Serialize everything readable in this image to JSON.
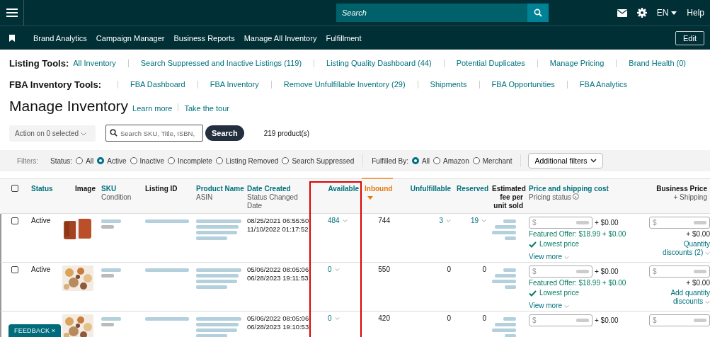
{
  "top_bar": {
    "search": {
      "placeholder": "Search"
    },
    "language": "EN",
    "help": "Help"
  },
  "nav": {
    "items": [
      "Brand Analytics",
      "Campaign Manager",
      "Business Reports",
      "Manage All Inventory",
      "Fulfillment"
    ],
    "edit_button": "Edit"
  },
  "listing_tools": {
    "label": "Listing Tools:",
    "links": [
      "All Inventory",
      "Search Suppressed and Inactive Listings (119)",
      "Listing Quality Dashboard (44)",
      "Potential Duplicates",
      "Manage Pricing",
      "Brand Health (0)"
    ]
  },
  "fba_tools": {
    "label": "FBA Inventory Tools:",
    "links": [
      "FBA Dashboard",
      "FBA Inventory",
      "Remove Unfulfillable Inventory (29)",
      "Shipments",
      "FBA Opportunities",
      "FBA Analytics"
    ]
  },
  "page": {
    "title": "Manage Inventory",
    "links": [
      "Learn more",
      "Take the tour"
    ]
  },
  "actions": {
    "action_dropdown": "Action on 0 selected",
    "search": {
      "placeholder": "Search SKU, Title, ISBN,"
    },
    "search_button": "Search",
    "count": "219 product(s)"
  },
  "filters": {
    "label": "Filters:",
    "status": {
      "label": "Status:",
      "options": [
        {
          "label": "All",
          "selected": false
        },
        {
          "label": "Active",
          "selected": true
        },
        {
          "label": "Inactive",
          "selected": false
        },
        {
          "label": "Incomplete",
          "selected": false
        },
        {
          "label": "Listing Removed",
          "selected": false
        },
        {
          "label": "Search Suppressed",
          "selected": false
        }
      ]
    },
    "fulfilled_by": {
      "label": "Fulfilled By:",
      "options": [
        {
          "label": "All",
          "selected": true
        },
        {
          "label": "Amazon",
          "selected": false
        },
        {
          "label": "Merchant",
          "selected": false
        }
      ]
    },
    "additional_button": "Additional filters"
  },
  "table": {
    "select_all": {
      "checked": false
    },
    "columns": [
      {
        "title": "Status",
        "link": true,
        "sorted": false
      },
      {
        "title": "Image",
        "link": false,
        "sorted": false
      },
      {
        "title": "SKU",
        "subtitle": "Condition",
        "link": true,
        "sorted": false
      },
      {
        "title": "Listing ID",
        "link": false,
        "sorted": false
      },
      {
        "title": "Product Name",
        "subtitle": "ASIN",
        "link": true,
        "sorted": false
      },
      {
        "title": "Date Created",
        "subtitle": "Status Changed Date",
        "link": true,
        "sorted": false
      },
      {
        "title": "Available",
        "link": true,
        "sorted": false
      },
      {
        "title": "Inbound",
        "link": true,
        "sorted": true
      },
      {
        "title": "Unfulfillable",
        "link": true,
        "sorted": false
      },
      {
        "title": "Reserved",
        "link": true,
        "sorted": false
      },
      {
        "title": "Estimated fee per unit sold",
        "link": false,
        "sorted": false
      },
      {
        "title": "Price and shipping cost",
        "subtitle": "Pricing status",
        "link": true,
        "sorted": false
      },
      {
        "title": "Business Price",
        "subtitle": "+ Shipping",
        "link": false,
        "sorted": false
      }
    ],
    "rows": [
      {
        "checked": false,
        "status": "Active",
        "date_created": "08/25/2021 06:55:50",
        "status_changed": "11/10/2022 01:17:52",
        "available": {
          "value": "484",
          "menu": true
        },
        "inbound": "744",
        "unfulfillable": {
          "value": "3",
          "menu": true
        },
        "reserved": {
          "value": "19",
          "menu": true
        },
        "price": {
          "currency": "$",
          "shipping": "+ $0.00",
          "featured_offer": "Featured Offer: $18.99 + $0.00",
          "pricing_status": "Lowest price",
          "view_more": "View more"
        },
        "business": {
          "currency": "$",
          "shipping": "+ $0.00",
          "discounts": "Quantity discounts (2)"
        }
      },
      {
        "checked": false,
        "status": "Active",
        "date_created": "05/06/2022 08:05:06",
        "status_changed": "06/28/2023 19:11:53",
        "available": {
          "value": "0",
          "menu": true
        },
        "inbound": "550",
        "unfulfillable": {
          "value": "0",
          "menu": false
        },
        "reserved": {
          "value": "0",
          "menu": false
        },
        "price": {
          "currency": "$",
          "shipping": "+ $0.00",
          "featured_offer": "Featured Offer: $18.99 + $0.00",
          "pricing_status": "Lowest price",
          "view_more": "View more"
        },
        "business": {
          "currency": "$",
          "shipping": "+ $0.00",
          "discounts": "Add quantity discounts"
        }
      },
      {
        "date_created": "05/06/2022 08:05:06",
        "status_changed": "06/28/2023 19:10:53",
        "available": {
          "value": "0",
          "menu": true
        },
        "inbound": "420",
        "unfulfillable": {
          "value": "0",
          "menu": false
        },
        "reserved": {
          "value": "0",
          "menu": false
        },
        "price": {
          "currency": "$",
          "shipping": "+ $0.00"
        },
        "business": {
          "currency": "$"
        }
      }
    ]
  },
  "feedback": {
    "label": "FEEDBACK",
    "close": "×"
  }
}
